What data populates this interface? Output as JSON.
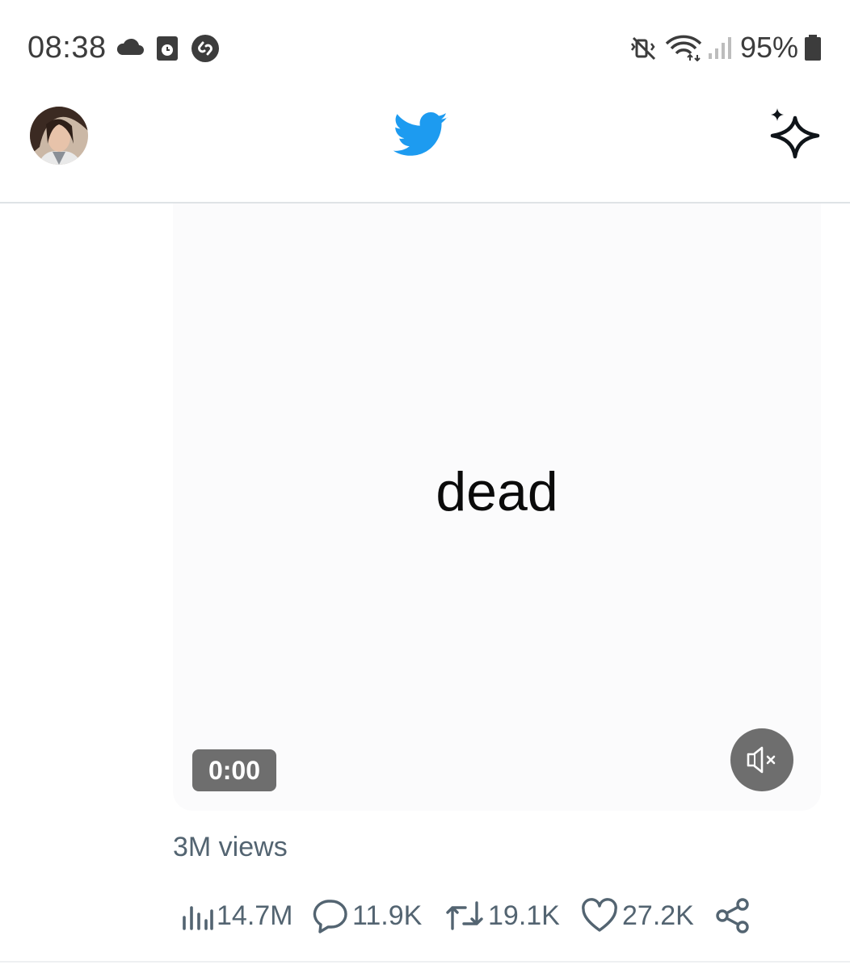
{
  "status_bar": {
    "time": "08:38",
    "battery": "95%",
    "icons": [
      "cloud-icon",
      "calendar-clock-icon",
      "shazam-icon",
      "vibrate-mute-icon",
      "wifi-icon",
      "signal-icon",
      "battery-icon"
    ]
  },
  "header": {
    "avatar_alt": "profile-avatar",
    "logo": "twitter-bird-icon",
    "sparkle": "sparkle-icon"
  },
  "tweet": {
    "media_text": "dead",
    "timer": "0:00",
    "views": "3M views",
    "stats": {
      "impressions": "14.7M",
      "replies": "11.9K",
      "retweets": "19.1K",
      "likes": "27.2K"
    }
  },
  "colors": {
    "twitter_blue": "#1d9bf0",
    "muted_text": "#536471",
    "overlay_gray": "#6e6e6e"
  }
}
